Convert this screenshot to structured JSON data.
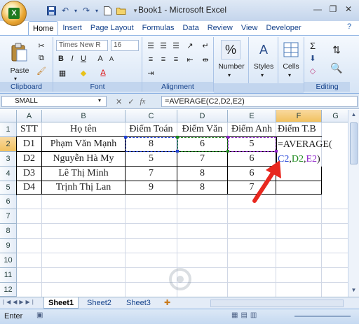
{
  "window": {
    "title": "Book1 - Microsoft Excel"
  },
  "tabs": [
    "Home",
    "Insert",
    "Page Layout",
    "Formulas",
    "Data",
    "Review",
    "View",
    "Developer"
  ],
  "ribbon": {
    "clipboard": {
      "label": "Clipboard",
      "paste": "Paste"
    },
    "font": {
      "label": "Font",
      "name": "Times New R",
      "size": "16"
    },
    "alignment": {
      "label": "Alignment"
    },
    "number": {
      "label": "Number"
    },
    "styles": {
      "label": "Styles"
    },
    "cells": {
      "label": "Cells"
    },
    "editing": {
      "label": "Editing"
    }
  },
  "formula_bar": {
    "name_box": "SMALL",
    "fx": "fx",
    "formula": "=AVERAGE(C2,D2,E2)"
  },
  "columns": [
    "A",
    "B",
    "C",
    "D",
    "E",
    "F",
    "G"
  ],
  "rows": [
    "1",
    "2",
    "3",
    "4",
    "5",
    "6",
    "7",
    "8",
    "9",
    "10",
    "11",
    "12"
  ],
  "cells": {
    "header": [
      "STT",
      "Họ tên",
      "Điểm Toán",
      "Điểm Văn",
      "Điểm Anh",
      "Điểm T.B"
    ],
    "data": [
      [
        "D1",
        "Phạm Văn Mạnh",
        "8",
        "6",
        "5"
      ],
      [
        "D2",
        "Nguyễn Hà My",
        "5",
        "7",
        "6"
      ],
      [
        "D3",
        "Lê Thị Minh",
        "7",
        "8",
        "6"
      ],
      [
        "D4",
        "Trịnh Thị Lan",
        "9",
        "8",
        "7"
      ]
    ],
    "f2_text": "=AVERAGE(",
    "f3_parts": [
      "C2",
      ",",
      "D2",
      ",",
      "E2",
      ")"
    ]
  },
  "sheets": [
    "Sheet1",
    "Sheet2",
    "Sheet3"
  ],
  "status": {
    "mode": "Enter"
  },
  "colors": {
    "ref_c": "#2142d6",
    "ref_d": "#1d8a1d",
    "ref_e": "#8e22c9",
    "arrow": "#e8281f"
  }
}
